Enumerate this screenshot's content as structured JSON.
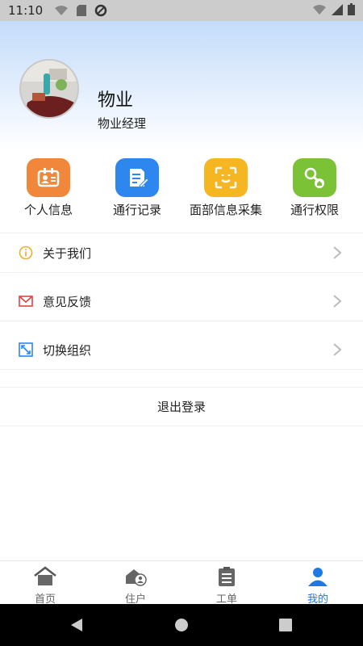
{
  "status_bar": {
    "time": "11:10"
  },
  "profile": {
    "name": "物业",
    "role": "物业经理"
  },
  "quick_actions": [
    {
      "label": "个人信息",
      "color": "#f0873a",
      "icon": "id-card-icon"
    },
    {
      "label": "通行记录",
      "color": "#2e87ef",
      "icon": "edit-record-icon"
    },
    {
      "label": "面部信息采集",
      "color": "#f6b622",
      "icon": "face-scan-icon"
    },
    {
      "label": "通行权限",
      "color": "#7cc236",
      "icon": "key-icon"
    }
  ],
  "menu": [
    {
      "label": "关于我们",
      "icon": "info-icon"
    },
    {
      "label": "意见反馈",
      "icon": "mail-icon"
    },
    {
      "label": "切换组织",
      "icon": "switch-icon"
    }
  ],
  "logout_label": "退出登录",
  "tabs": [
    {
      "label": "首页",
      "icon": "home-icon"
    },
    {
      "label": "住户",
      "icon": "resident-icon"
    },
    {
      "label": "工单",
      "icon": "work-order-icon"
    },
    {
      "label": "我的",
      "icon": "profile-icon",
      "active": true
    }
  ],
  "accent_color": "#1e79e6"
}
